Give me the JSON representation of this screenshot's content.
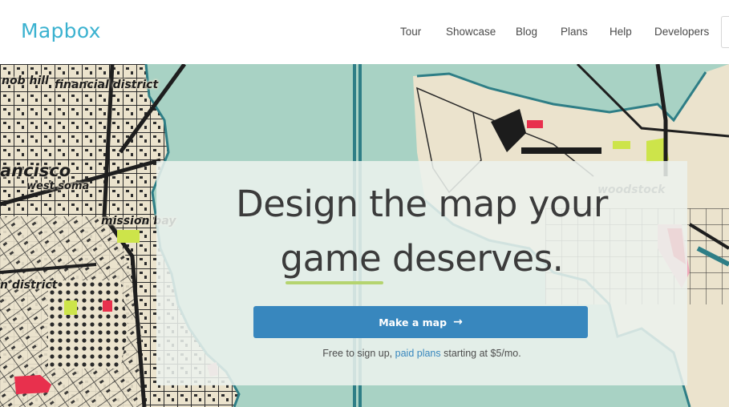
{
  "brand": {
    "logo_text": "Mapbox",
    "accent_color": "#3bb2d0"
  },
  "nav": {
    "items": [
      {
        "label": "Tour"
      },
      {
        "label": "Showcase"
      },
      {
        "label": "Blog"
      },
      {
        "label": "Plans"
      },
      {
        "label": "Help"
      },
      {
        "label": "Developers"
      }
    ]
  },
  "hero": {
    "headline_line1": "Design the map your",
    "headline_line2": "game deserves.",
    "underline_color": "#b5d46f",
    "cta": {
      "label": "Make a map",
      "icon": "arrow-right-icon",
      "bg_color": "#3887be",
      "text_color": "#ffffff"
    },
    "note": {
      "prefix": "Free to sign up,",
      "link_text": "paid plans",
      "suffix": "starting at $5/mo.",
      "link_color": "#3887be"
    }
  },
  "map": {
    "water_color": "#a8d2c4",
    "land_color": "#ece4cf",
    "labels": [
      {
        "text": "nob hill"
      },
      {
        "text": "financial district"
      },
      {
        "text": "ancisco"
      },
      {
        "text": "west soma"
      },
      {
        "text": "mission bay"
      },
      {
        "text": "n district"
      },
      {
        "text": "woodstock"
      }
    ]
  }
}
